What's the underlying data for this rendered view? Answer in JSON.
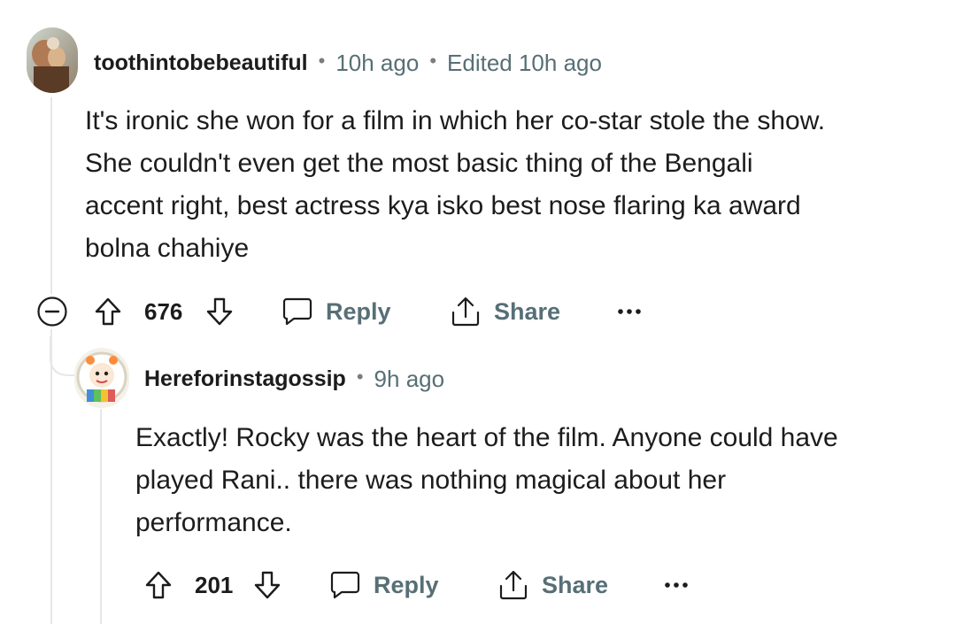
{
  "comments": [
    {
      "username": "toothintobebeautiful",
      "time": "10h ago",
      "edited": "Edited 10h ago",
      "body_lines": [
        "It's ironic she won for a film in which her co-star stole the show.",
        "She couldn't even get the most basic thing of the Bengali",
        "accent right, best actress kya isko best nose flaring ka award",
        "bolna chahiye"
      ],
      "votes": "676",
      "reply_label": "Reply",
      "share_label": "Share"
    },
    {
      "username": "Hereforinstagossip",
      "time": "9h ago",
      "body_lines": [
        "Exactly! Rocky was the heart of the film. Anyone could have",
        "played Rani.. there was nothing magical about her",
        "performance."
      ],
      "votes": "201",
      "reply_label": "Reply",
      "share_label": "Share"
    }
  ],
  "meta_separator": "•",
  "colors": {
    "text": "#1c1c1c",
    "meta": "#576f76",
    "thread_line": "#e5e7e9"
  },
  "icons": [
    "collapse-icon",
    "upvote-icon",
    "downvote-icon",
    "reply-icon",
    "share-icon",
    "more-icon"
  ]
}
